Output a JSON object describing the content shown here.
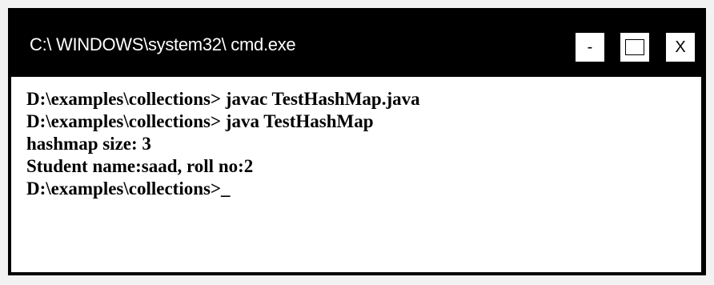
{
  "window": {
    "title": "C:\\ WINDOWS\\system32\\ cmd.exe",
    "buttons": {
      "minimize_label": "-",
      "close_label": "X"
    }
  },
  "console": {
    "lines": [
      "D:\\examples\\collections> javac TestHashMap.java",
      "D:\\examples\\collections> java TestHashMap",
      "hashmap size: 3",
      "Student name:saad, roll no:2",
      "D:\\examples\\collections>_"
    ]
  },
  "colors": {
    "titlebar": "#000000",
    "console_background": "#ffffff",
    "console_text": "#000000",
    "title_text": "#ffffff"
  }
}
